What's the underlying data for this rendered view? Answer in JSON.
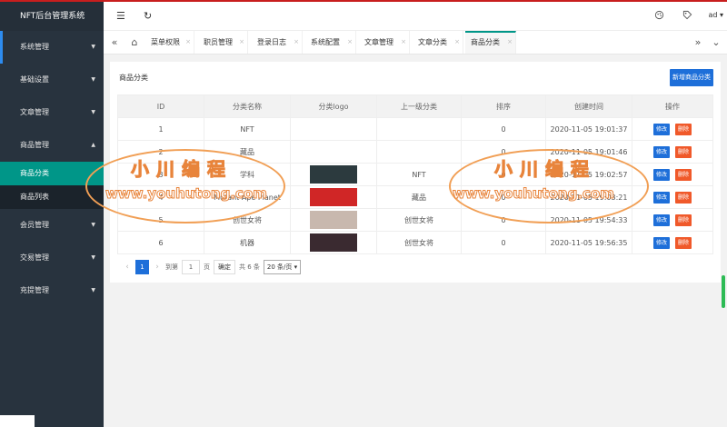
{
  "app": {
    "title": "NFT后台管理系统"
  },
  "sidebar": {
    "items": [
      {
        "label": "系统管理",
        "arrow": "▼"
      },
      {
        "label": "基础设置",
        "arrow": "▼"
      },
      {
        "label": "文章管理",
        "arrow": "▼"
      },
      {
        "label": "商品管理",
        "arrow": "▲"
      },
      {
        "label": "会员管理",
        "arrow": "▼"
      },
      {
        "label": "交易管理",
        "arrow": "▼"
      },
      {
        "label": "充提管理",
        "arrow": "▼"
      }
    ],
    "sub_items": [
      {
        "label": "商品分类"
      },
      {
        "label": "商品列表"
      }
    ]
  },
  "header": {
    "menu_icon": "☰",
    "refresh_icon": "↻",
    "user": "ad ▾"
  },
  "tabs": {
    "prev_icon": "«",
    "home_icon": "⌂",
    "next_icon": "»",
    "more_icon": "⌄",
    "close_glyph": "×",
    "items": [
      {
        "label": "菜单权限"
      },
      {
        "label": "职员管理"
      },
      {
        "label": "登录日志"
      },
      {
        "label": "系统配置"
      },
      {
        "label": "文章管理"
      },
      {
        "label": "文章分类"
      },
      {
        "label": "商品分类"
      }
    ]
  },
  "page": {
    "title": "商品分类",
    "add_button": "新增商品分类"
  },
  "table": {
    "headers": [
      "ID",
      "分类名称",
      "分类logo",
      "上一级分类",
      "排序",
      "创建时间",
      "操作"
    ],
    "edit_label": "修改",
    "delete_label": "删除",
    "rows": [
      {
        "id": "1",
        "name": "NFT",
        "parent": "",
        "sort": "0",
        "created": "2020-11-05 19:01:37"
      },
      {
        "id": "2",
        "name": "藏品",
        "parent": "",
        "sort": "0",
        "created": "2020-11-05 19:01:46"
      },
      {
        "id": "3",
        "name": "学科",
        "parent": "NFT",
        "sort": "0",
        "created": "2020-11-05 19:02:57"
      },
      {
        "id": "4",
        "name": "Mutant Ape Planet",
        "parent": "藏品",
        "sort": "0",
        "created": "2020-11-05 19:03:21"
      },
      {
        "id": "5",
        "name": "创世女将",
        "parent": "创世女将",
        "sort": "0",
        "created": "2020-11-05 19:54:33"
      },
      {
        "id": "6",
        "name": "机器",
        "parent": "创世女将",
        "sort": "0",
        "created": "2020-11-05 19:56:35"
      }
    ],
    "logo_colors": [
      "",
      "",
      "#2c3a3e",
      "#d02626",
      "#c8b8ae",
      "#3a2a30"
    ]
  },
  "pager": {
    "prev": "‹",
    "current": "1",
    "next": "›",
    "goto_label": "到第",
    "goto_value": "1",
    "page_unit": "页",
    "confirm": "确定",
    "total": "共 6 条",
    "page_size": "20 条/页 ▾"
  },
  "watermark": {
    "cn": "小川编程",
    "url": "www.youhutong.com"
  }
}
